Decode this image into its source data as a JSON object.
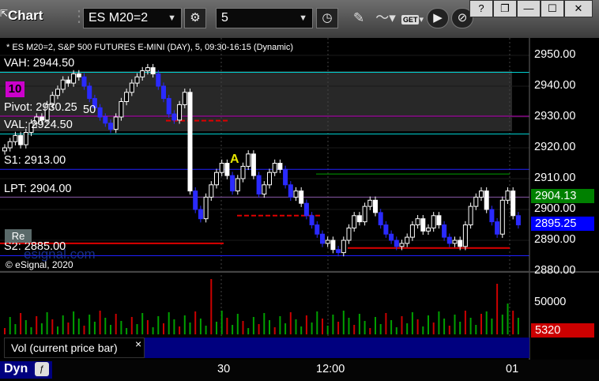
{
  "app": {
    "title": "Chart"
  },
  "window_controls": {
    "help": "?",
    "restore": "❐",
    "minimize": "—",
    "maximize": "☐",
    "close": "✕"
  },
  "toolbar": {
    "symbol": "ES M20=2",
    "interval": "5",
    "get_label": "GET"
  },
  "chart": {
    "header": "* ES M20=2, S&P 500 FUTURES E-MINI (DAY), 5, 09:30-16:15 (Dynamic)",
    "copyright": "© eSignal, 2020",
    "watermark": "esignal.com",
    "levels": {
      "vah": "VAH: 2944.50",
      "pivot": "Pivot: 2930.25",
      "val": "VAL: 2924.50",
      "s1": "S1: 2913.00",
      "lpt": "LPT: 2904.00",
      "s2": "S2: 2885.00"
    },
    "overlay_text": {
      "ten": "10",
      "fifty": "50",
      "a_marker": "A",
      "re_button": "Re"
    },
    "price_axis": [
      "2950.00",
      "2940.00",
      "2930.00",
      "2920.00",
      "2910.00",
      "2900.00",
      "2890.00",
      "2880.00"
    ],
    "price_tags": {
      "green": "2904.13",
      "blue": "2895.25"
    },
    "volume_axis": "50000",
    "volume_tag": "5320",
    "time_axis": [
      "30",
      "12:00",
      "01"
    ],
    "volume_legend": "Vol (current price bar)",
    "volume_legend_close": "×"
  },
  "bottom": {
    "dyn_label": "Dyn"
  },
  "colors": {
    "green_tag": "#008000",
    "blue_tag": "#0000ff",
    "red_tag": "#cc0000",
    "bg": "#000000"
  },
  "chart_data": {
    "type": "candlestick",
    "title": "* ES M20=2, S&P 500 FUTURES E-MINI (DAY), 5, 09:30-16:15 (Dynamic)",
    "y_axis": {
      "ylim": [
        2878,
        2954
      ],
      "ticks": [
        2950,
        2940,
        2930,
        2920,
        2910,
        2900,
        2890,
        2880
      ]
    },
    "x_ticks": [
      "30",
      "12:00",
      "01"
    ],
    "levels": {
      "VAH": 2944.5,
      "Pivot": 2930.25,
      "VAL": 2924.5,
      "S1": 2913.0,
      "LPT": 2904.0,
      "S2": 2885.0
    },
    "last_prices": {
      "green": 2904.13,
      "blue": 2895.25
    },
    "closes": [
      2920,
      2922,
      2924,
      2921,
      2925,
      2928,
      2930,
      2929,
      2934,
      2937,
      2939,
      2942,
      2941,
      2944,
      2943,
      2940,
      2936,
      2933,
      2930,
      2928,
      2926,
      2930,
      2935,
      2938,
      2941,
      2943,
      2945,
      2946,
      2944,
      2940,
      2936,
      2931,
      2929,
      2934,
      2938,
      2906,
      2900,
      2897,
      2904,
      2908,
      2912,
      2915,
      2911,
      2906,
      2910,
      2914,
      2918,
      2911,
      2905,
      2908,
      2912,
      2915,
      2913,
      2908,
      2904,
      2906,
      2902,
      2898,
      2895,
      2892,
      2889,
      2890,
      2887,
      2886,
      2890,
      2894,
      2898,
      2896,
      2901,
      2903,
      2899,
      2895,
      2892,
      2890,
      2888,
      2889,
      2891,
      2895,
      2897,
      2893,
      2894,
      2898,
      2895,
      2891,
      2889,
      2890,
      2888,
      2895,
      2901,
      2904,
      2906,
      2900,
      2896,
      2892,
      2903,
      2906,
      2898,
      2895
    ],
    "volume_axis_label": 50000,
    "current_volume": 5320
  }
}
